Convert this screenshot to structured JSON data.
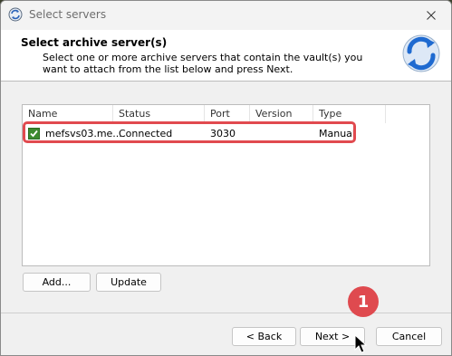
{
  "window": {
    "title": "Select servers"
  },
  "header": {
    "title": "Select archive server(s)",
    "description": "Select one or more archive servers that contain the vault(s) you want to attach from the list below and press Next."
  },
  "table": {
    "columns": [
      "Name",
      "Status",
      "Port",
      "Version",
      "Type"
    ],
    "rows": [
      {
        "checked": true,
        "name": "mefsvs03.me...",
        "status": "Connected",
        "port": "3030",
        "version": "",
        "type": "Manual"
      }
    ]
  },
  "actions": {
    "add_label": "Add...",
    "update_label": "Update"
  },
  "nav": {
    "back_label": "< Back",
    "next_label": "Next >",
    "cancel_label": "Cancel"
  },
  "annotation": {
    "step": "1",
    "color": "#e14a4f"
  },
  "colors": {
    "checkbox": "#3b8a2f",
    "badge": "#df4a4f"
  }
}
